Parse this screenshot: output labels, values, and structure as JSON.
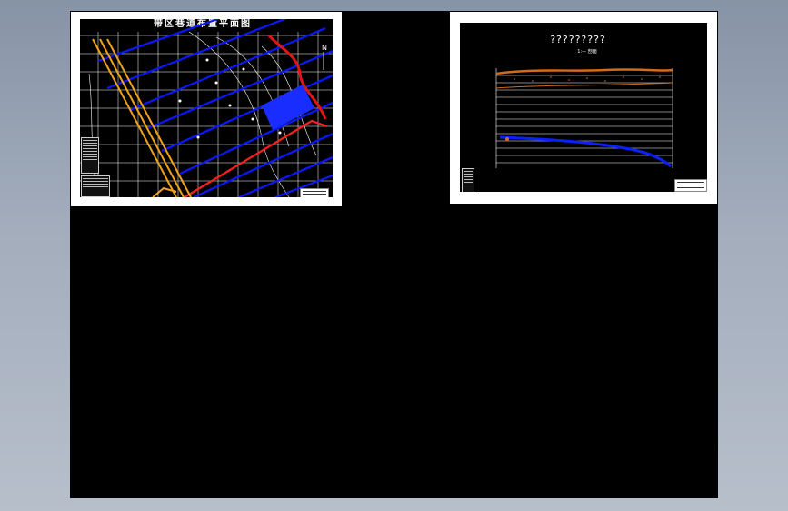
{
  "viewport": {
    "background": "#000000",
    "frame_color": "#ffffff"
  },
  "sheets": [
    {
      "id": "plan",
      "title": "带区巷道布置平面图",
      "colors": {
        "roads": "#0b18ff",
        "boundary": "#ff1f1f",
        "fault": "#f0a21a",
        "grid": "#ffffff"
      },
      "north_label": "N"
    },
    {
      "id": "profile",
      "title": "?????????",
      "subtitle": "1:— 剖面",
      "colors": {
        "layer_top": "#d46a1a",
        "seam": "#0a20ff",
        "lines": "#ffffff"
      }
    }
  ]
}
